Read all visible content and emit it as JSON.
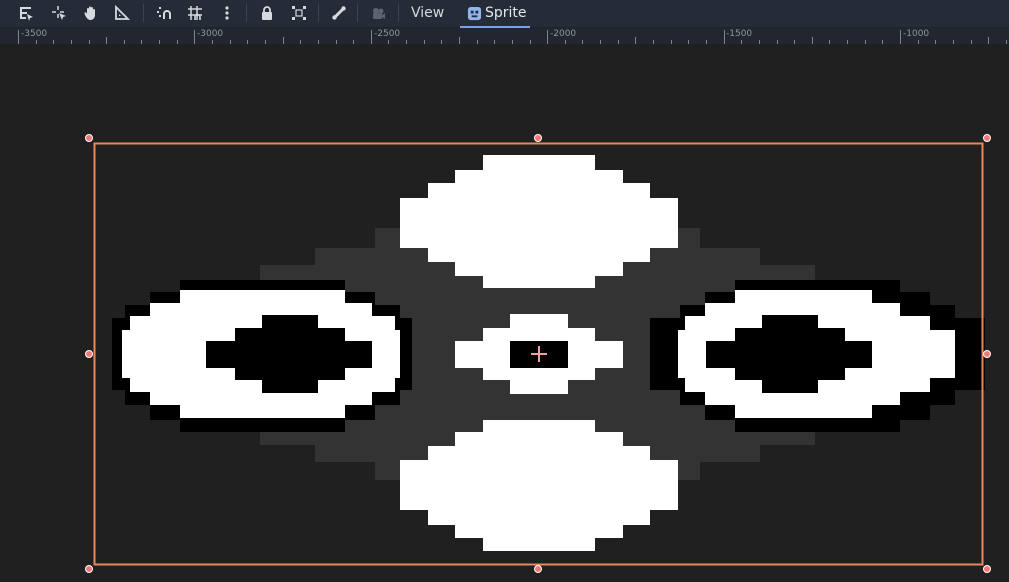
{
  "toolbar": {
    "icons": [
      "select-icon",
      "move-icon",
      "pan-icon",
      "ruler-icon",
      "smart-snap-icon",
      "grid-snap-icon",
      "more-icon",
      "lock-icon",
      "group-icon",
      "skeleton-icon",
      "camera-icon"
    ],
    "view_label": "View",
    "sprite_label": "Sprite"
  },
  "ruler": {
    "labels": [
      "-3500",
      "-3000",
      "-2500",
      "-2000",
      "-1500",
      "-1000"
    ]
  },
  "colors": {
    "selection": "#e8885f",
    "handle": "#f07070",
    "sprite_gray": "#333333",
    "sprite_white": "#ffffff",
    "sprite_black": "#000000",
    "accent": "#7aa1e8"
  }
}
